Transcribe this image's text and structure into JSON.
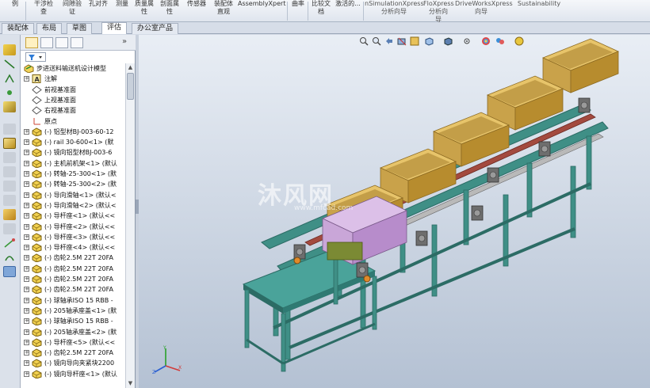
{
  "ribbon": {
    "items": [
      {
        "label": "例"
      },
      {
        "label": "干涉检\n查"
      },
      {
        "label": "间隙验\n证"
      },
      {
        "label": "孔对齐"
      },
      {
        "label": "测量"
      },
      {
        "label": "质量属\n性"
      },
      {
        "label": "剖面属\n性"
      },
      {
        "label": "传感器"
      },
      {
        "label": "装配体\n直观"
      },
      {
        "label": "AssemblyXpert"
      },
      {
        "label": "曲率"
      },
      {
        "label": "比较文\n档"
      },
      {
        "label": "激活的..."
      },
      {
        "label": "nSimulationXpress\n分析向导"
      },
      {
        "label": "FloXpress\n分析向\n导"
      },
      {
        "label": "DriveWorksXpress\n向导"
      },
      {
        "label": "Sustainability"
      }
    ]
  },
  "tabs": [
    {
      "label": "装配体"
    },
    {
      "label": "布局"
    },
    {
      "label": "草图"
    },
    {
      "label": "评估"
    },
    {
      "label": "办公室产品"
    }
  ],
  "feature_manager": {
    "expand_arrows": "»",
    "filter_icon": "filter-icon",
    "root": {
      "label": "步进送料输送机设计模型"
    },
    "nodes": [
      {
        "label": "注解",
        "icon": "annotation-icon"
      },
      {
        "label": "前视基准面",
        "icon": "plane-icon"
      },
      {
        "label": "上视基准面",
        "icon": "plane-icon"
      },
      {
        "label": "右视基准面",
        "icon": "plane-icon"
      },
      {
        "label": "原点",
        "icon": "origin-icon"
      },
      {
        "label": "(-) 铝型材BJ-003-60-12",
        "icon": "part-icon"
      },
      {
        "label": "(-) rail 30-600<1> (默",
        "icon": "part-icon"
      },
      {
        "label": "(-) 镜向铝型材BJ-003-6",
        "icon": "part-icon"
      },
      {
        "label": "(-) 主机前机架<1> (默认",
        "icon": "part-icon"
      },
      {
        "label": "(-) 转轴-25-300<1> (默",
        "icon": "part-icon"
      },
      {
        "label": "(-) 转轴-25-300<2> (默",
        "icon": "part-icon"
      },
      {
        "label": "(-) 导向滑轴<1> (默认<",
        "icon": "part-icon"
      },
      {
        "label": "(-) 导向滑轴<2> (默认<",
        "icon": "part-icon"
      },
      {
        "label": "(-) 导杆座<1> (默认<<",
        "icon": "part-icon"
      },
      {
        "label": "(-) 导杆座<2> (默认<<",
        "icon": "part-icon"
      },
      {
        "label": "(-) 导杆座<3> (默认<<",
        "icon": "part-icon"
      },
      {
        "label": "(-) 导杆座<4> (默认<<",
        "icon": "part-icon"
      },
      {
        "label": "(-) 齿轮2.5M 22T 20FA",
        "icon": "part-icon"
      },
      {
        "label": "(-) 齿轮2.5M 22T 20FA",
        "icon": "part-icon"
      },
      {
        "label": "(-) 齿轮2.5M 22T 20FA",
        "icon": "part-icon"
      },
      {
        "label": "(-) 齿轮2.5M 22T 20FA",
        "icon": "part-icon"
      },
      {
        "label": "(-) 球轴承ISO 15 RBB -",
        "icon": "part-icon"
      },
      {
        "label": "(-) 205轴承座盖<1> (默",
        "icon": "part-icon"
      },
      {
        "label": "(-) 球轴承ISO 15 RBB -",
        "icon": "part-icon"
      },
      {
        "label": "(-) 205轴承座盖<2> (默",
        "icon": "part-icon"
      },
      {
        "label": "(-) 导杆座<5> (默认<<",
        "icon": "part-icon"
      },
      {
        "label": "(-) 齿轮2.5M 22T 20FA",
        "icon": "part-icon"
      },
      {
        "label": "(-) 镜向导向夹紧块2200",
        "icon": "part-icon"
      },
      {
        "label": "(-) 镜向导杆座<1> (默认",
        "icon": "part-icon"
      }
    ]
  },
  "watermark": {
    "text": "沐风网",
    "sub": "www.mfcad.com"
  },
  "colors": {
    "frame": "#3f8f86",
    "frame_dark": "#2c6c65",
    "bin": "#c9a24a",
    "bin_dark": "#8c6a22",
    "rail": "#a34a3f",
    "purple": "#c9a6d8",
    "roller": "#5a5a5a"
  }
}
